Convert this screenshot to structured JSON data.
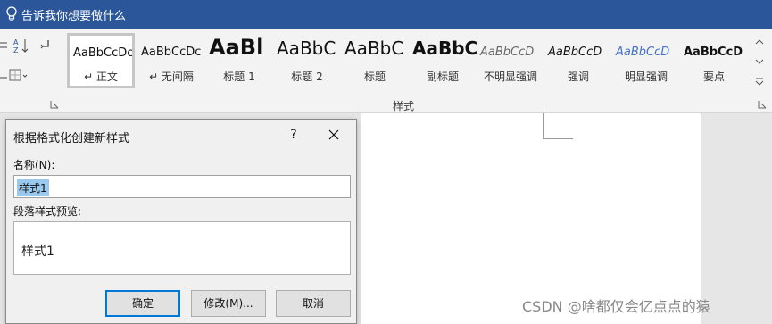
{
  "tell_me": {
    "text": "告诉我你想要做什么",
    "icon": "lightbulb-icon"
  },
  "ribbon": {
    "styles_group_label": "样式",
    "styles": [
      {
        "sample": "AaBbCcDc",
        "name": "↵ 正文",
        "active": true
      },
      {
        "sample": "AaBbCcDc",
        "name": "↵ 无间隔",
        "active": false
      },
      {
        "sample": "AaBl",
        "name": "标题 1",
        "active": false
      },
      {
        "sample": "AaBbC",
        "name": "标题 2",
        "active": false
      },
      {
        "sample": "AaBbC",
        "name": "标题",
        "active": false
      },
      {
        "sample": "AaBbC",
        "name": "副标题",
        "active": false
      },
      {
        "sample": "AaBbCcD",
        "name": "不明显强调",
        "active": false
      },
      {
        "sample": "AaBbCcD",
        "name": "强调",
        "active": false
      },
      {
        "sample": "AaBbCcD",
        "name": "明显强调",
        "active": false
      },
      {
        "sample": "AaBbCcD",
        "name": "要点",
        "active": false
      }
    ]
  },
  "dialog": {
    "title": "根据格式化创建新样式",
    "help_label": "?",
    "name_label": "名称(N):",
    "name_value": "样式1",
    "preview_label": "段落样式预览:",
    "preview_text": "样式1",
    "buttons": {
      "ok": "确定",
      "modify": "修改(M)...",
      "cancel": "取消"
    }
  },
  "watermark": "CSDN @啥都仅会亿点点的猿",
  "colors": {
    "title_bar": "#2b579a",
    "selection": "#99c9ef",
    "default_button_border": "#0078d7"
  }
}
